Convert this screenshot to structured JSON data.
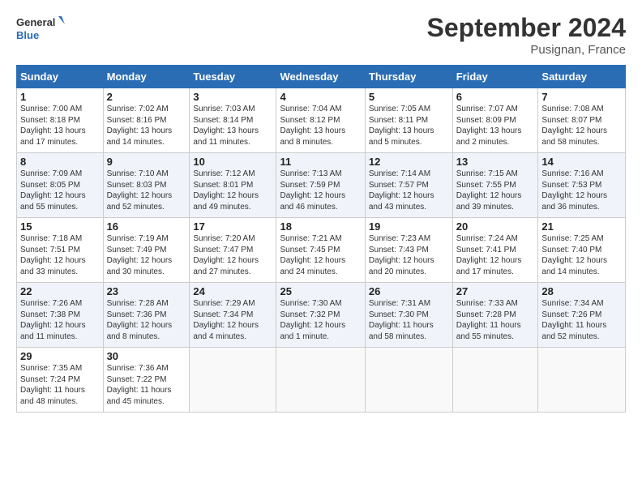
{
  "header": {
    "logo_line1": "General",
    "logo_line2": "Blue",
    "month_title": "September 2024",
    "location": "Pusignan, France"
  },
  "days_of_week": [
    "Sunday",
    "Monday",
    "Tuesday",
    "Wednesday",
    "Thursday",
    "Friday",
    "Saturday"
  ],
  "weeks": [
    [
      {
        "day": "1",
        "info": "Sunrise: 7:00 AM\nSunset: 8:18 PM\nDaylight: 13 hours\nand 17 minutes."
      },
      {
        "day": "2",
        "info": "Sunrise: 7:02 AM\nSunset: 8:16 PM\nDaylight: 13 hours\nand 14 minutes."
      },
      {
        "day": "3",
        "info": "Sunrise: 7:03 AM\nSunset: 8:14 PM\nDaylight: 13 hours\nand 11 minutes."
      },
      {
        "day": "4",
        "info": "Sunrise: 7:04 AM\nSunset: 8:12 PM\nDaylight: 13 hours\nand 8 minutes."
      },
      {
        "day": "5",
        "info": "Sunrise: 7:05 AM\nSunset: 8:11 PM\nDaylight: 13 hours\nand 5 minutes."
      },
      {
        "day": "6",
        "info": "Sunrise: 7:07 AM\nSunset: 8:09 PM\nDaylight: 13 hours\nand 2 minutes."
      },
      {
        "day": "7",
        "info": "Sunrise: 7:08 AM\nSunset: 8:07 PM\nDaylight: 12 hours\nand 58 minutes."
      }
    ],
    [
      {
        "day": "8",
        "info": "Sunrise: 7:09 AM\nSunset: 8:05 PM\nDaylight: 12 hours\nand 55 minutes."
      },
      {
        "day": "9",
        "info": "Sunrise: 7:10 AM\nSunset: 8:03 PM\nDaylight: 12 hours\nand 52 minutes."
      },
      {
        "day": "10",
        "info": "Sunrise: 7:12 AM\nSunset: 8:01 PM\nDaylight: 12 hours\nand 49 minutes."
      },
      {
        "day": "11",
        "info": "Sunrise: 7:13 AM\nSunset: 7:59 PM\nDaylight: 12 hours\nand 46 minutes."
      },
      {
        "day": "12",
        "info": "Sunrise: 7:14 AM\nSunset: 7:57 PM\nDaylight: 12 hours\nand 43 minutes."
      },
      {
        "day": "13",
        "info": "Sunrise: 7:15 AM\nSunset: 7:55 PM\nDaylight: 12 hours\nand 39 minutes."
      },
      {
        "day": "14",
        "info": "Sunrise: 7:16 AM\nSunset: 7:53 PM\nDaylight: 12 hours\nand 36 minutes."
      }
    ],
    [
      {
        "day": "15",
        "info": "Sunrise: 7:18 AM\nSunset: 7:51 PM\nDaylight: 12 hours\nand 33 minutes."
      },
      {
        "day": "16",
        "info": "Sunrise: 7:19 AM\nSunset: 7:49 PM\nDaylight: 12 hours\nand 30 minutes."
      },
      {
        "day": "17",
        "info": "Sunrise: 7:20 AM\nSunset: 7:47 PM\nDaylight: 12 hours\nand 27 minutes."
      },
      {
        "day": "18",
        "info": "Sunrise: 7:21 AM\nSunset: 7:45 PM\nDaylight: 12 hours\nand 24 minutes."
      },
      {
        "day": "19",
        "info": "Sunrise: 7:23 AM\nSunset: 7:43 PM\nDaylight: 12 hours\nand 20 minutes."
      },
      {
        "day": "20",
        "info": "Sunrise: 7:24 AM\nSunset: 7:41 PM\nDaylight: 12 hours\nand 17 minutes."
      },
      {
        "day": "21",
        "info": "Sunrise: 7:25 AM\nSunset: 7:40 PM\nDaylight: 12 hours\nand 14 minutes."
      }
    ],
    [
      {
        "day": "22",
        "info": "Sunrise: 7:26 AM\nSunset: 7:38 PM\nDaylight: 12 hours\nand 11 minutes."
      },
      {
        "day": "23",
        "info": "Sunrise: 7:28 AM\nSunset: 7:36 PM\nDaylight: 12 hours\nand 8 minutes."
      },
      {
        "day": "24",
        "info": "Sunrise: 7:29 AM\nSunset: 7:34 PM\nDaylight: 12 hours\nand 4 minutes."
      },
      {
        "day": "25",
        "info": "Sunrise: 7:30 AM\nSunset: 7:32 PM\nDaylight: 12 hours\nand 1 minute."
      },
      {
        "day": "26",
        "info": "Sunrise: 7:31 AM\nSunset: 7:30 PM\nDaylight: 11 hours\nand 58 minutes."
      },
      {
        "day": "27",
        "info": "Sunrise: 7:33 AM\nSunset: 7:28 PM\nDaylight: 11 hours\nand 55 minutes."
      },
      {
        "day": "28",
        "info": "Sunrise: 7:34 AM\nSunset: 7:26 PM\nDaylight: 11 hours\nand 52 minutes."
      }
    ],
    [
      {
        "day": "29",
        "info": "Sunrise: 7:35 AM\nSunset: 7:24 PM\nDaylight: 11 hours\nand 48 minutes."
      },
      {
        "day": "30",
        "info": "Sunrise: 7:36 AM\nSunset: 7:22 PM\nDaylight: 11 hours\nand 45 minutes."
      },
      {
        "day": "",
        "info": ""
      },
      {
        "day": "",
        "info": ""
      },
      {
        "day": "",
        "info": ""
      },
      {
        "day": "",
        "info": ""
      },
      {
        "day": "",
        "info": ""
      }
    ]
  ]
}
